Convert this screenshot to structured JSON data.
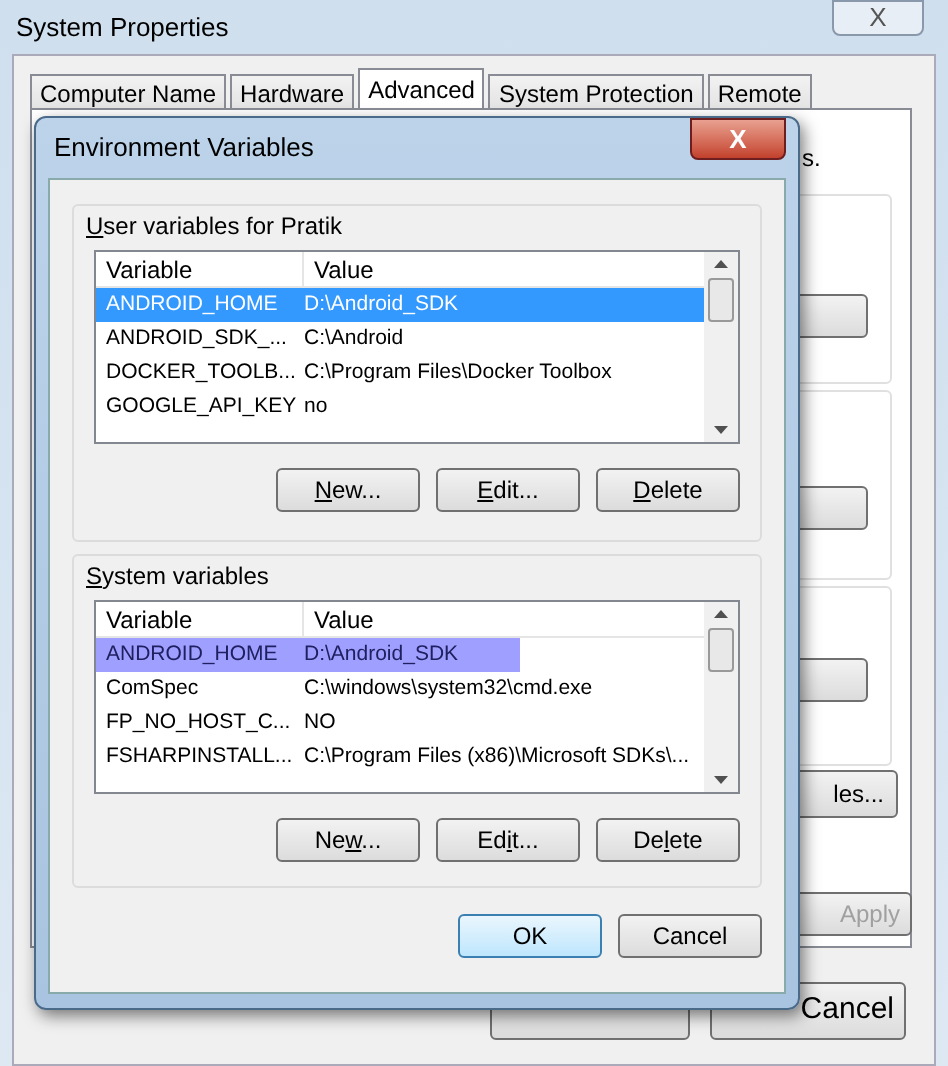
{
  "back_window": {
    "title": "System Properties",
    "close": "X",
    "tabs": [
      {
        "label": "Computer Name",
        "selected": false
      },
      {
        "label": "Hardware",
        "selected": false
      },
      {
        "label": "Advanced",
        "selected": true
      },
      {
        "label": "System Protection",
        "selected": false
      },
      {
        "label": "Remote",
        "selected": false
      }
    ],
    "panel_text": "s.",
    "env_button": "les...",
    "buttons": [
      {
        "label": "Apply",
        "disabled": true
      },
      {
        "label": "Cancel",
        "disabled": false
      }
    ]
  },
  "dialog": {
    "title": "Environment Variables",
    "close": "X",
    "groups": [
      {
        "label": {
          "key": "U",
          "rest": "ser variables for Pratik"
        },
        "focused": true,
        "columns": [
          "Variable",
          "Value"
        ],
        "rows": [
          {
            "variable": "ANDROID_HOME",
            "value": "D:\\Android_SDK",
            "selected": true
          },
          {
            "variable": "ANDROID_SDK_...",
            "value": "C:\\Android",
            "selected": false
          },
          {
            "variable": "DOCKER_TOOLB...",
            "value": "C:\\Program Files\\Docker Toolbox",
            "selected": false
          },
          {
            "variable": "GOOGLE_API_KEY",
            "value": "no",
            "selected": false
          }
        ],
        "buttons": [
          {
            "key": "N",
            "rest": "ew..."
          },
          {
            "key": "E",
            "rest": "dit..."
          },
          {
            "key": "D",
            "rest": "elete"
          }
        ]
      },
      {
        "label": {
          "key": "S",
          "rest": "ystem variables"
        },
        "focused": false,
        "columns": [
          "Variable",
          "Value"
        ],
        "rows": [
          {
            "variable": "ANDROID_HOME",
            "value": "D:\\Android_SDK",
            "selected": true
          },
          {
            "variable": "ComSpec",
            "value": "C:\\windows\\system32\\cmd.exe",
            "selected": false
          },
          {
            "variable": "FP_NO_HOST_C...",
            "value": "NO",
            "selected": false
          },
          {
            "variable": "FSHARPINSTALL...",
            "value": "C:\\Program Files (x86)\\Microsoft SDKs\\...",
            "selected": false
          }
        ],
        "buttons": [
          {
            "pre": "Ne",
            "key": "w",
            "rest": "..."
          },
          {
            "pre": "Ed",
            "key": "i",
            "rest": "t..."
          },
          {
            "pre": "De",
            "key": "l",
            "rest": "ete"
          }
        ]
      }
    ],
    "buttons": [
      {
        "label": "OK",
        "default": true
      },
      {
        "label": "Cancel",
        "default": false
      }
    ]
  }
}
